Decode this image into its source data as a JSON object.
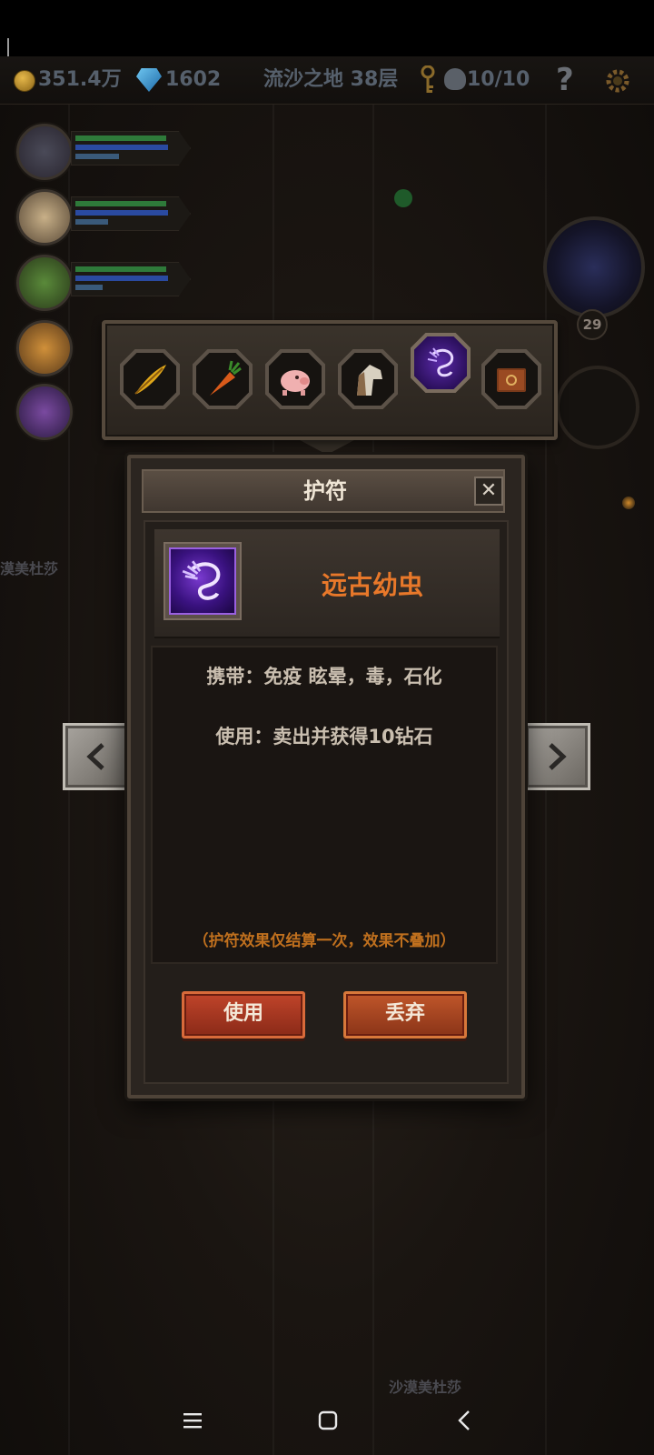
{
  "topbar": {
    "gold": "351.4万",
    "diamonds": "1602",
    "floor": "流沙之地 38层",
    "kills": "10/10",
    "help": "?"
  },
  "background": {
    "enemy_label_left": "漠美杜莎",
    "enemy_label_bottom": "沙漠美杜莎",
    "level_badge": "29"
  },
  "item_bar": {
    "slots": [
      {
        "icon": "golden-feather-icon"
      },
      {
        "icon": "carrot-icon"
      },
      {
        "icon": "piggy-bank-icon"
      },
      {
        "icon": "horse-head-icon"
      },
      {
        "icon": "ancient-larva-icon",
        "selected": true
      },
      {
        "icon": "spellbook-icon"
      }
    ]
  },
  "dialog": {
    "title": "护符",
    "close": "✕",
    "item_name": "远古幼虫",
    "carry_text": "携带：免疫 眩晕，毒，石化",
    "use_text": "使用：卖出并获得10钻石",
    "note": "（护符效果仅结算一次，效果不叠加）",
    "use_button": "使用",
    "discard_button": "丢弃"
  },
  "colors": {
    "accent_orange": "#e8782a",
    "button_red": "#c0442a",
    "item_purple": "#7a3ad0"
  }
}
